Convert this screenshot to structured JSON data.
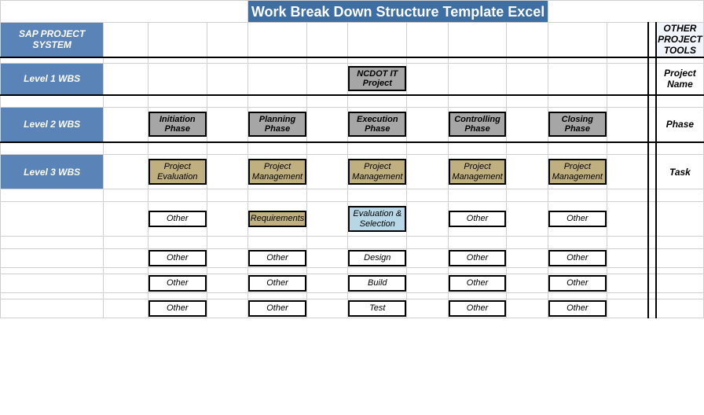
{
  "title": "Work Break Down Structure Template Excel",
  "left": {
    "sap": "SAP PROJECT SYSTEM",
    "l1": "Level 1 WBS",
    "l2": "Level 2 WBS",
    "l3": "Level 3 WBS"
  },
  "right": {
    "other_tools": "OTHER PROJECT TOOLS",
    "project_name": "Project Name",
    "phase": "Phase",
    "task": "Task"
  },
  "top": {
    "ncdot": "NCDOT IT Project"
  },
  "phases": {
    "c1": "Initiation Phase",
    "c2": "Planning Phase",
    "c3": "Execution Phase",
    "c4": "Controlling Phase",
    "c5": "Closing Phase"
  },
  "tasksA": {
    "c1": "Project Evaluation",
    "c2": "Project Management",
    "c3": "Project Management",
    "c4": "Project Management",
    "c5": "Project Management"
  },
  "tasksB": {
    "c1": "Other",
    "c2": "Requirements",
    "c3": "Evaluation & Selection",
    "c4": "Other",
    "c5": "Other"
  },
  "rowC": {
    "c1": "Other",
    "c2": "Other",
    "c3": "Design",
    "c4": "Other",
    "c5": "Other"
  },
  "rowD": {
    "c1": "Other",
    "c2": "Other",
    "c3": "Build",
    "c4": "Other",
    "c5": "Other"
  },
  "rowE": {
    "c1": "Other",
    "c2": "Other",
    "c3": "Test",
    "c4": "Other",
    "c5": "Other"
  }
}
